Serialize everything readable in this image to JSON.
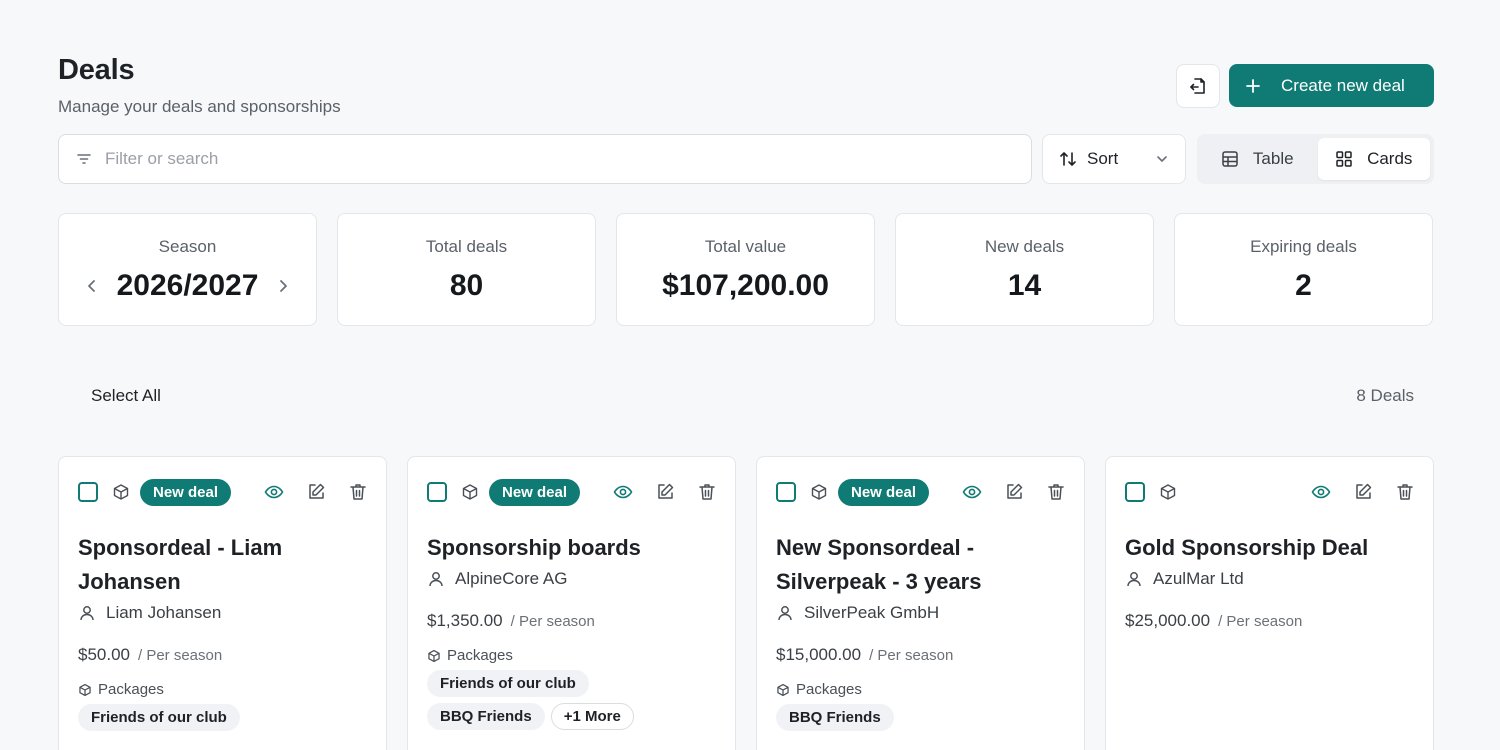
{
  "header": {
    "title": "Deals",
    "subtitle": "Manage your deals and sponsorships",
    "create_label": "Create new deal"
  },
  "colors": {
    "accent": "#0f7b74"
  },
  "toolbar": {
    "search_placeholder": "Filter or search",
    "sort_label": "Sort",
    "view_table": "Table",
    "view_cards": "Cards",
    "active_view": "Cards"
  },
  "stats": {
    "season": {
      "label": "Season",
      "value": "2026/2027"
    },
    "total_deals": {
      "label": "Total deals",
      "value": "80"
    },
    "total_value": {
      "label": "Total value",
      "value": "$107,200.00"
    },
    "new_deals": {
      "label": "New deals",
      "value": "14"
    },
    "expiring_deals": {
      "label": "Expiring deals",
      "value": "2"
    }
  },
  "list": {
    "select_all": "Select All",
    "count": "8 Deals"
  },
  "cards": [
    {
      "badge": "New deal",
      "title": "Sponsordeal - Liam Johansen",
      "company": "Liam Johansen",
      "price": "$50.00",
      "period": "/ Per season",
      "packages_label": "Packages",
      "chips": [
        "Friends of our club"
      ]
    },
    {
      "badge": "New deal",
      "title": "Sponsorship boards",
      "company": "AlpineCore AG",
      "price": "$1,350.00",
      "period": "/ Per season",
      "packages_label": "Packages",
      "chips": [
        "Friends of our club",
        "BBQ Friends",
        "+1 More"
      ]
    },
    {
      "badge": "New deal",
      "title": "New Sponsordeal - Silverpeak - 3 years",
      "company": "SilverPeak GmbH",
      "price": "$15,000.00",
      "period": "/ Per season",
      "packages_label": "Packages",
      "chips": [
        "BBQ Friends"
      ]
    },
    {
      "title": "Gold Sponsorship Deal",
      "company": "AzulMar Ltd",
      "price": "$25,000.00",
      "period": "/ Per season"
    }
  ]
}
